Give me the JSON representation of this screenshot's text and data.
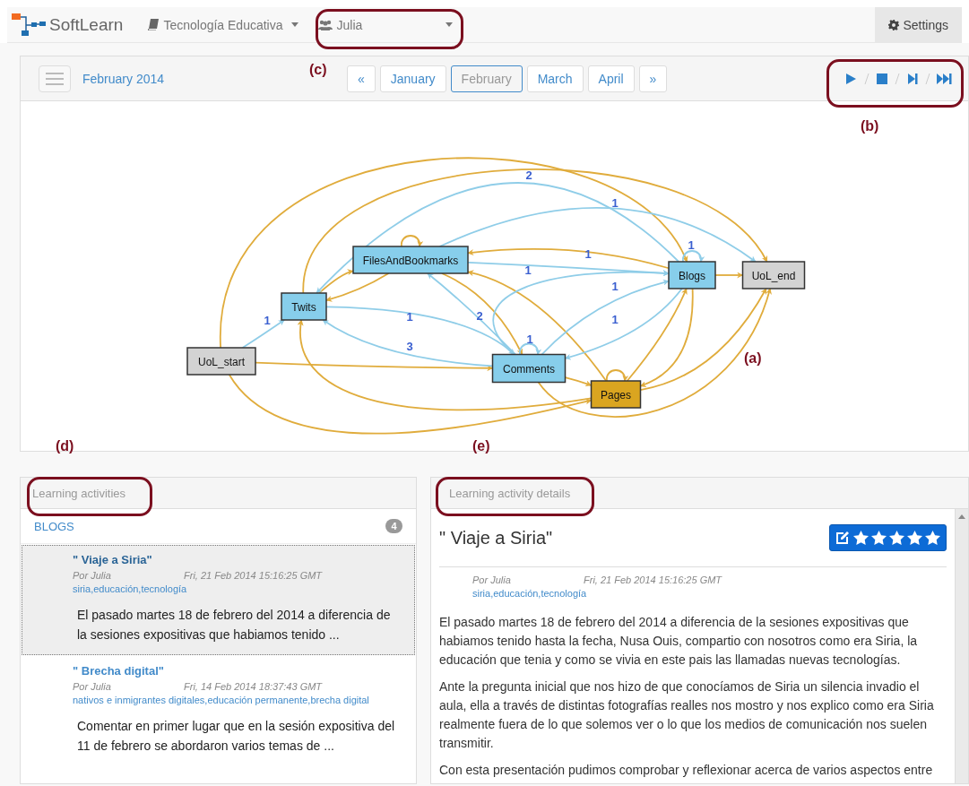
{
  "navbar": {
    "brand": "SoftLearn",
    "course": "Tecnología Educativa",
    "user": "Julia",
    "settings": "Settings"
  },
  "toolbar": {
    "period": "February 2014",
    "pages": [
      {
        "label": "«",
        "selected": false
      },
      {
        "label": "January",
        "selected": false
      },
      {
        "label": "February",
        "selected": true
      },
      {
        "label": "March",
        "selected": false
      },
      {
        "label": "April",
        "selected": false
      },
      {
        "label": "»",
        "selected": false
      }
    ],
    "player": [
      {
        "kind": "play"
      },
      {
        "kind": "stop"
      },
      {
        "kind": "step"
      },
      {
        "kind": "end"
      }
    ]
  },
  "graph": {
    "nodes": [
      {
        "label": "UoL_start",
        "color": "#d3d3d3"
      },
      {
        "label": "Twits",
        "color": "#87ceeb"
      },
      {
        "label": "FilesAndBookmarks",
        "color": "#87ceeb"
      },
      {
        "label": "Blogs",
        "color": "#87ceeb"
      },
      {
        "label": "UoL_end",
        "color": "#d3d3d3"
      },
      {
        "label": "Comments",
        "color": "#87ceeb"
      },
      {
        "label": "Pages",
        "color": "#daa520"
      }
    ],
    "edges": [
      {
        "label": "2"
      },
      {
        "label": "1"
      },
      {
        "label": "1"
      },
      {
        "label": "1"
      },
      {
        "label": "1"
      },
      {
        "label": "1"
      },
      {
        "label": "1"
      },
      {
        "label": "1"
      },
      {
        "label": "2"
      },
      {
        "label": "1"
      },
      {
        "label": "1"
      },
      {
        "label": "3"
      }
    ]
  },
  "activities": {
    "header": "Learning activities",
    "group": "BLOGS",
    "count": "4",
    "items": [
      {
        "title": "\" Viaje a Siria\"",
        "author": "Por Julia",
        "date": "Fri, 21 Feb 2014 15:16:25 GMT",
        "tags": "siria,educación,tecnología",
        "excerpt": "El pasado martes 18 de febrero del 2014 a diferencia de la sesiones expositivas que habiamos tenido ...",
        "selected": true
      },
      {
        "title": "\" Brecha digital\"",
        "author": "Por Julia",
        "date": "Fri, 14 Feb 2014 18:37:43 GMT",
        "tags": "nativos e inmigrantes digitales,educación permanente,brecha digital",
        "excerpt": "Comentar en primer lugar que en la sesión expositiva del 11 de febrero se abordaron varios temas de ...",
        "selected": false
      }
    ]
  },
  "details": {
    "header": "Learning activity details",
    "title": "\" Viaje a Siria\"",
    "stars": 5,
    "author": "Por Julia",
    "date": "Fri, 21 Feb 2014 15:16:25 GMT",
    "tags": "siria,educación,tecnología",
    "paragraphs": [
      "El pasado martes 18 de febrero del 2014 a diferencia de la sesiones expositivas que habiamos tenido hasta la fecha, Nusa Ouis, compartio con nosotros como era Siria, la educación que tenia y como se vivia en este pais las llamadas nuevas tecnologías.",
      "Ante la pregunta inicial que nos hizo de que conocíamos de Siria un silencia invadio el aula, ella a través de distintas fotografías realles nos mostro y nos explico como era Siria realmente fuera de lo que solemos ver o lo que los medios de comunicación nos suelen transmitir.",
      "Con esta presentación pudimos comprobar y reflexionar acerca de varios aspectos entre"
    ]
  },
  "annotations": [
    {
      "label": "(c)"
    },
    {
      "label": "(b)"
    },
    {
      "label": "(a)"
    },
    {
      "label": "(d)"
    },
    {
      "label": "(e)"
    }
  ]
}
